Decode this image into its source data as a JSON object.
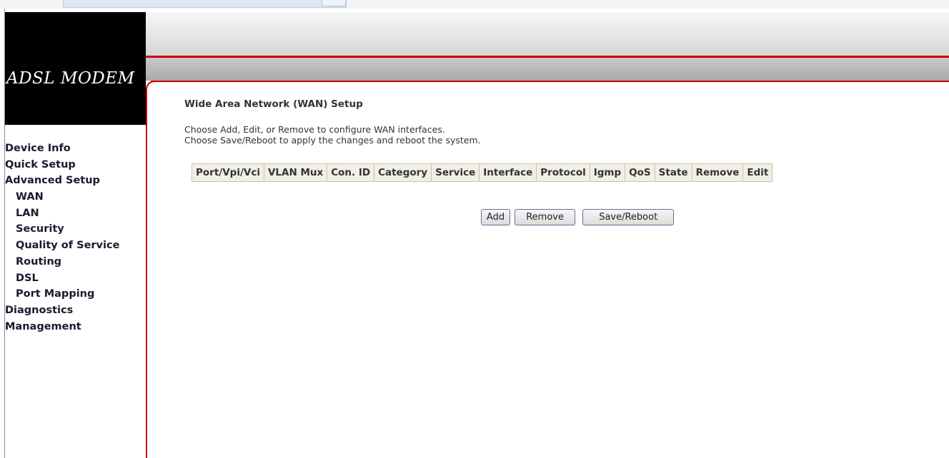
{
  "logo": {
    "text": "ADSL MODEM"
  },
  "sidebar": {
    "items": [
      {
        "label": "Device Info",
        "sub": false
      },
      {
        "label": "Quick Setup",
        "sub": false
      },
      {
        "label": "Advanced Setup",
        "sub": false
      },
      {
        "label": "WAN",
        "sub": true
      },
      {
        "label": "LAN",
        "sub": true
      },
      {
        "label": "Security",
        "sub": true
      },
      {
        "label": "Quality of Service",
        "sub": true
      },
      {
        "label": "Routing",
        "sub": true
      },
      {
        "label": "DSL",
        "sub": true
      },
      {
        "label": "Port Mapping",
        "sub": true
      },
      {
        "label": "Diagnostics",
        "sub": false
      },
      {
        "label": "Management",
        "sub": false
      }
    ]
  },
  "main": {
    "title": "Wide Area Network (WAN) Setup",
    "description": [
      "Choose Add, Edit, or Remove to configure WAN interfaces.",
      "Choose Save/Reboot to apply the changes and reboot the system."
    ],
    "table": {
      "columns": [
        "Port/Vpi/Vci",
        "VLAN Mux",
        "Con. ID",
        "Category",
        "Service",
        "Interface",
        "Protocol",
        "Igmp",
        "QoS",
        "State",
        "Remove",
        "Edit"
      ],
      "rows": []
    },
    "buttons": {
      "add": "Add",
      "remove": "Remove",
      "save_reboot": "Save/Reboot"
    }
  },
  "colors": {
    "accent_red": "#cc0000",
    "logo_bg": "#000000",
    "table_header_bg": "#f1efe4"
  }
}
